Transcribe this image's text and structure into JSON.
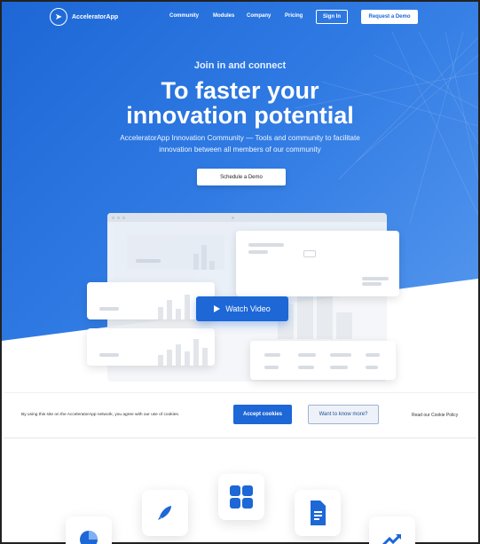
{
  "brand": {
    "name": "AcceleratorApp",
    "icon": "rocket-icon"
  },
  "nav": {
    "links": [
      "Community",
      "Modules",
      "Company",
      "Pricing"
    ],
    "signin": "Sign In",
    "request_demo": "Request a Demo"
  },
  "hero": {
    "kicker": "Join in and connect",
    "headline_line1": "To faster your",
    "headline_line2": "innovation potential",
    "subtitle": "AcceleratorApp Innovation Community — Tools and community to facilitate innovation between all members of our community",
    "schedule_button": "Schedule a Demo",
    "watch_video": "Watch Video"
  },
  "cookie_banner": {
    "message": "By using this site on the AcceleratorApp network, you agree with our use of cookies.",
    "accept": "Accept cookies",
    "more": "Want to know more?",
    "policy": "Read our Cookie Policy"
  },
  "features": [
    {
      "icon": "pie-chart-icon"
    },
    {
      "icon": "rocket-icon"
    },
    {
      "icon": "apps-grid-icon"
    },
    {
      "icon": "document-icon"
    },
    {
      "icon": "trend-up-icon"
    }
  ],
  "colors": {
    "primary": "#1d67d6",
    "hero_light": "#5a9bef"
  }
}
